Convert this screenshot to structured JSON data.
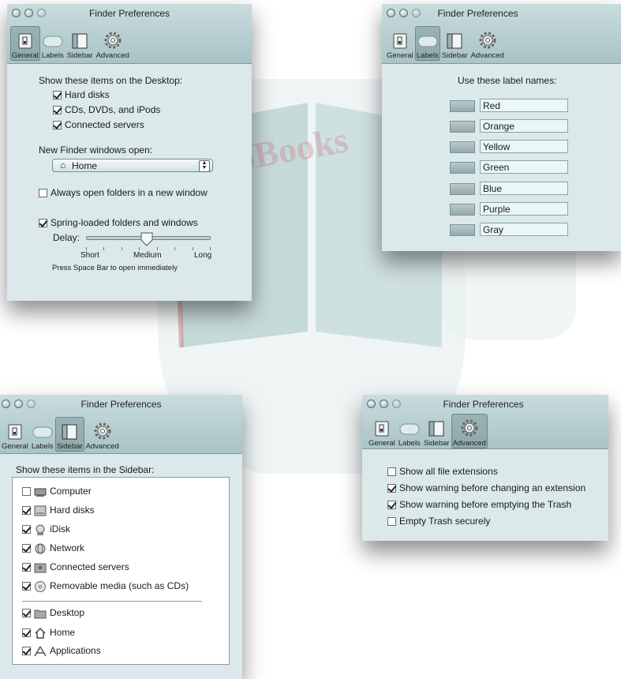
{
  "window_title": "Finder Preferences",
  "toolbar": {
    "general": "General",
    "labels": "Labels",
    "sidebar": "Sidebar",
    "advanced": "Advanced"
  },
  "watermark": "DropBooks",
  "general": {
    "desktop_heading": "Show these items on the Desktop:",
    "desktop_items": [
      {
        "label": "Hard disks",
        "checked": true
      },
      {
        "label": "CDs, DVDs, and iPods",
        "checked": true
      },
      {
        "label": "Connected servers",
        "checked": true
      }
    ],
    "new_windows_heading": "New Finder windows open:",
    "new_windows_value": "Home",
    "always_new_window": {
      "label": "Always open folders in a new window",
      "checked": false
    },
    "spring_loaded": {
      "label": "Spring-loaded folders and windows",
      "checked": true
    },
    "delay_label": "Delay:",
    "delay_short": "Short",
    "delay_medium": "Medium",
    "delay_long": "Long",
    "hint": "Press Space Bar to open immediately"
  },
  "labels": {
    "heading": "Use these label names:",
    "names": [
      "Red",
      "Orange",
      "Yellow",
      "Green",
      "Blue",
      "Purple",
      "Gray"
    ]
  },
  "sidebar": {
    "heading": "Show these items in the Sidebar:",
    "group1": [
      {
        "label": "Computer",
        "checked": false,
        "icon": "computer-icon"
      },
      {
        "label": "Hard disks",
        "checked": true,
        "icon": "hard-disk-icon"
      },
      {
        "label": "iDisk",
        "checked": true,
        "icon": "idisk-icon"
      },
      {
        "label": "Network",
        "checked": true,
        "icon": "network-icon"
      },
      {
        "label": "Connected servers",
        "checked": true,
        "icon": "server-icon"
      },
      {
        "label": "Removable media (such as CDs)",
        "checked": true,
        "icon": "cd-icon"
      }
    ],
    "group2": [
      {
        "label": "Desktop",
        "checked": true,
        "icon": "desktop-folder-icon"
      },
      {
        "label": "Home",
        "checked": true,
        "icon": "home-icon"
      },
      {
        "label": "Applications",
        "checked": true,
        "icon": "applications-icon"
      }
    ]
  },
  "advanced": {
    "options": [
      {
        "label": "Show all file extensions",
        "checked": false
      },
      {
        "label": "Show warning before changing an extension",
        "checked": true
      },
      {
        "label": "Show warning before emptying the Trash",
        "checked": true
      },
      {
        "label": "Empty Trash securely",
        "checked": false
      }
    ]
  }
}
